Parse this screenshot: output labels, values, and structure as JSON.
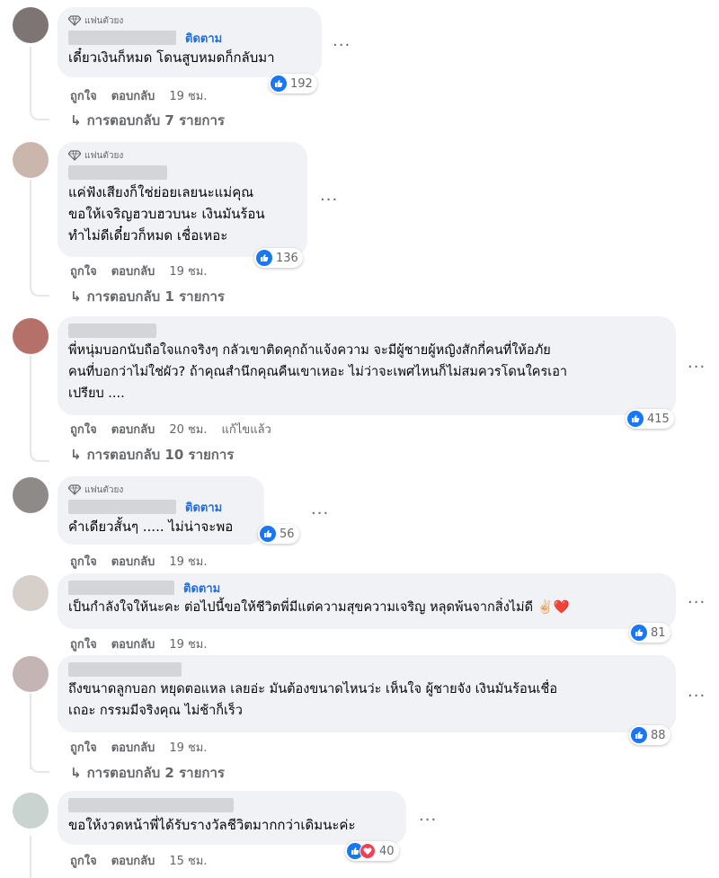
{
  "labels": {
    "top_fan": "แฟนตัวยง",
    "follow": "ติดตาม",
    "like": "ถูกใจ",
    "reply": "ตอบกลับ",
    "edited": "แก้ไขแล้ว",
    "more": "···"
  },
  "colors": {
    "like": "#1877f2",
    "love": "#f33e58",
    "follow": "#216fdb"
  },
  "comments": [
    {
      "text": "เดี๋ยวเงินก็หมด โดนสูบหมดก็กลับมา",
      "time": "19 ชม.",
      "reactions": "192",
      "replies": "การตอบกลับ 7 รายการ"
    },
    {
      "text": "แค่ฟังเสียงก็ใช่ย่อยเลยนะแม่คุณ\nขอให้เจริญฮวบฮวบนะ เงินมันร้อน\nทำไม่ดีเดี๋ยวก็หมด เชื่อเหอะ",
      "time": "19 ชม.",
      "reactions": "136",
      "replies": "การตอบกลับ 1 รายการ"
    },
    {
      "text": "พี่หนุ่มบอกนับถือใจแกจริงๆ กลัวเขาติดคุกถ้าแจ้งความ จะมีผู้ชายผู้หญิงสักกี่คนที่ให้อภัย\nคนที่บอกว่าไม่ใช่ผัว? ถ้าคุณสำนึกคุณคืนเขาเหอะ ไม่ว่าจะเพศไหนก็ไม่สมควรโดนใครเอา\nเปรียบ ....",
      "time": "20 ชม.",
      "reactions": "415",
      "replies": "การตอบกลับ 10 รายการ"
    },
    {
      "text": "คำเดียวสั้นๆ ..... ไม่น่าจะพอ",
      "time": "19 ชม.",
      "reactions": "56"
    },
    {
      "text": "เป็นกำลังใจให้นะคะ ต่อไปนี้ขอให้ชีวิตพี่มีแต่ความสุขความเจริญ หลุดพ้นจากสิ่งไม่ดี ✌🏻❤️",
      "time": "19 ชม.",
      "reactions": "81"
    },
    {
      "text": "ถึงขนาดลูกบอก หยุดตอแหล เลยอ่ะ มันต้องขนาดไหนว่ะ เห็นใจ ผู้ชายจัง เงินมันร้อนเชื่อ\nเถอะ กรรมมีจริงคุณ ไม่ช้าก็เร็ว",
      "time": "19 ชม.",
      "reactions": "88",
      "replies": "การตอบกลับ 2 รายการ"
    },
    {
      "text": "ขอให้งวดหน้าพี่ได้รับรางวัลชีวิตมากกว่าเดิมนะค่ะ",
      "time": "15 ชม.",
      "reactions": "40"
    }
  ]
}
